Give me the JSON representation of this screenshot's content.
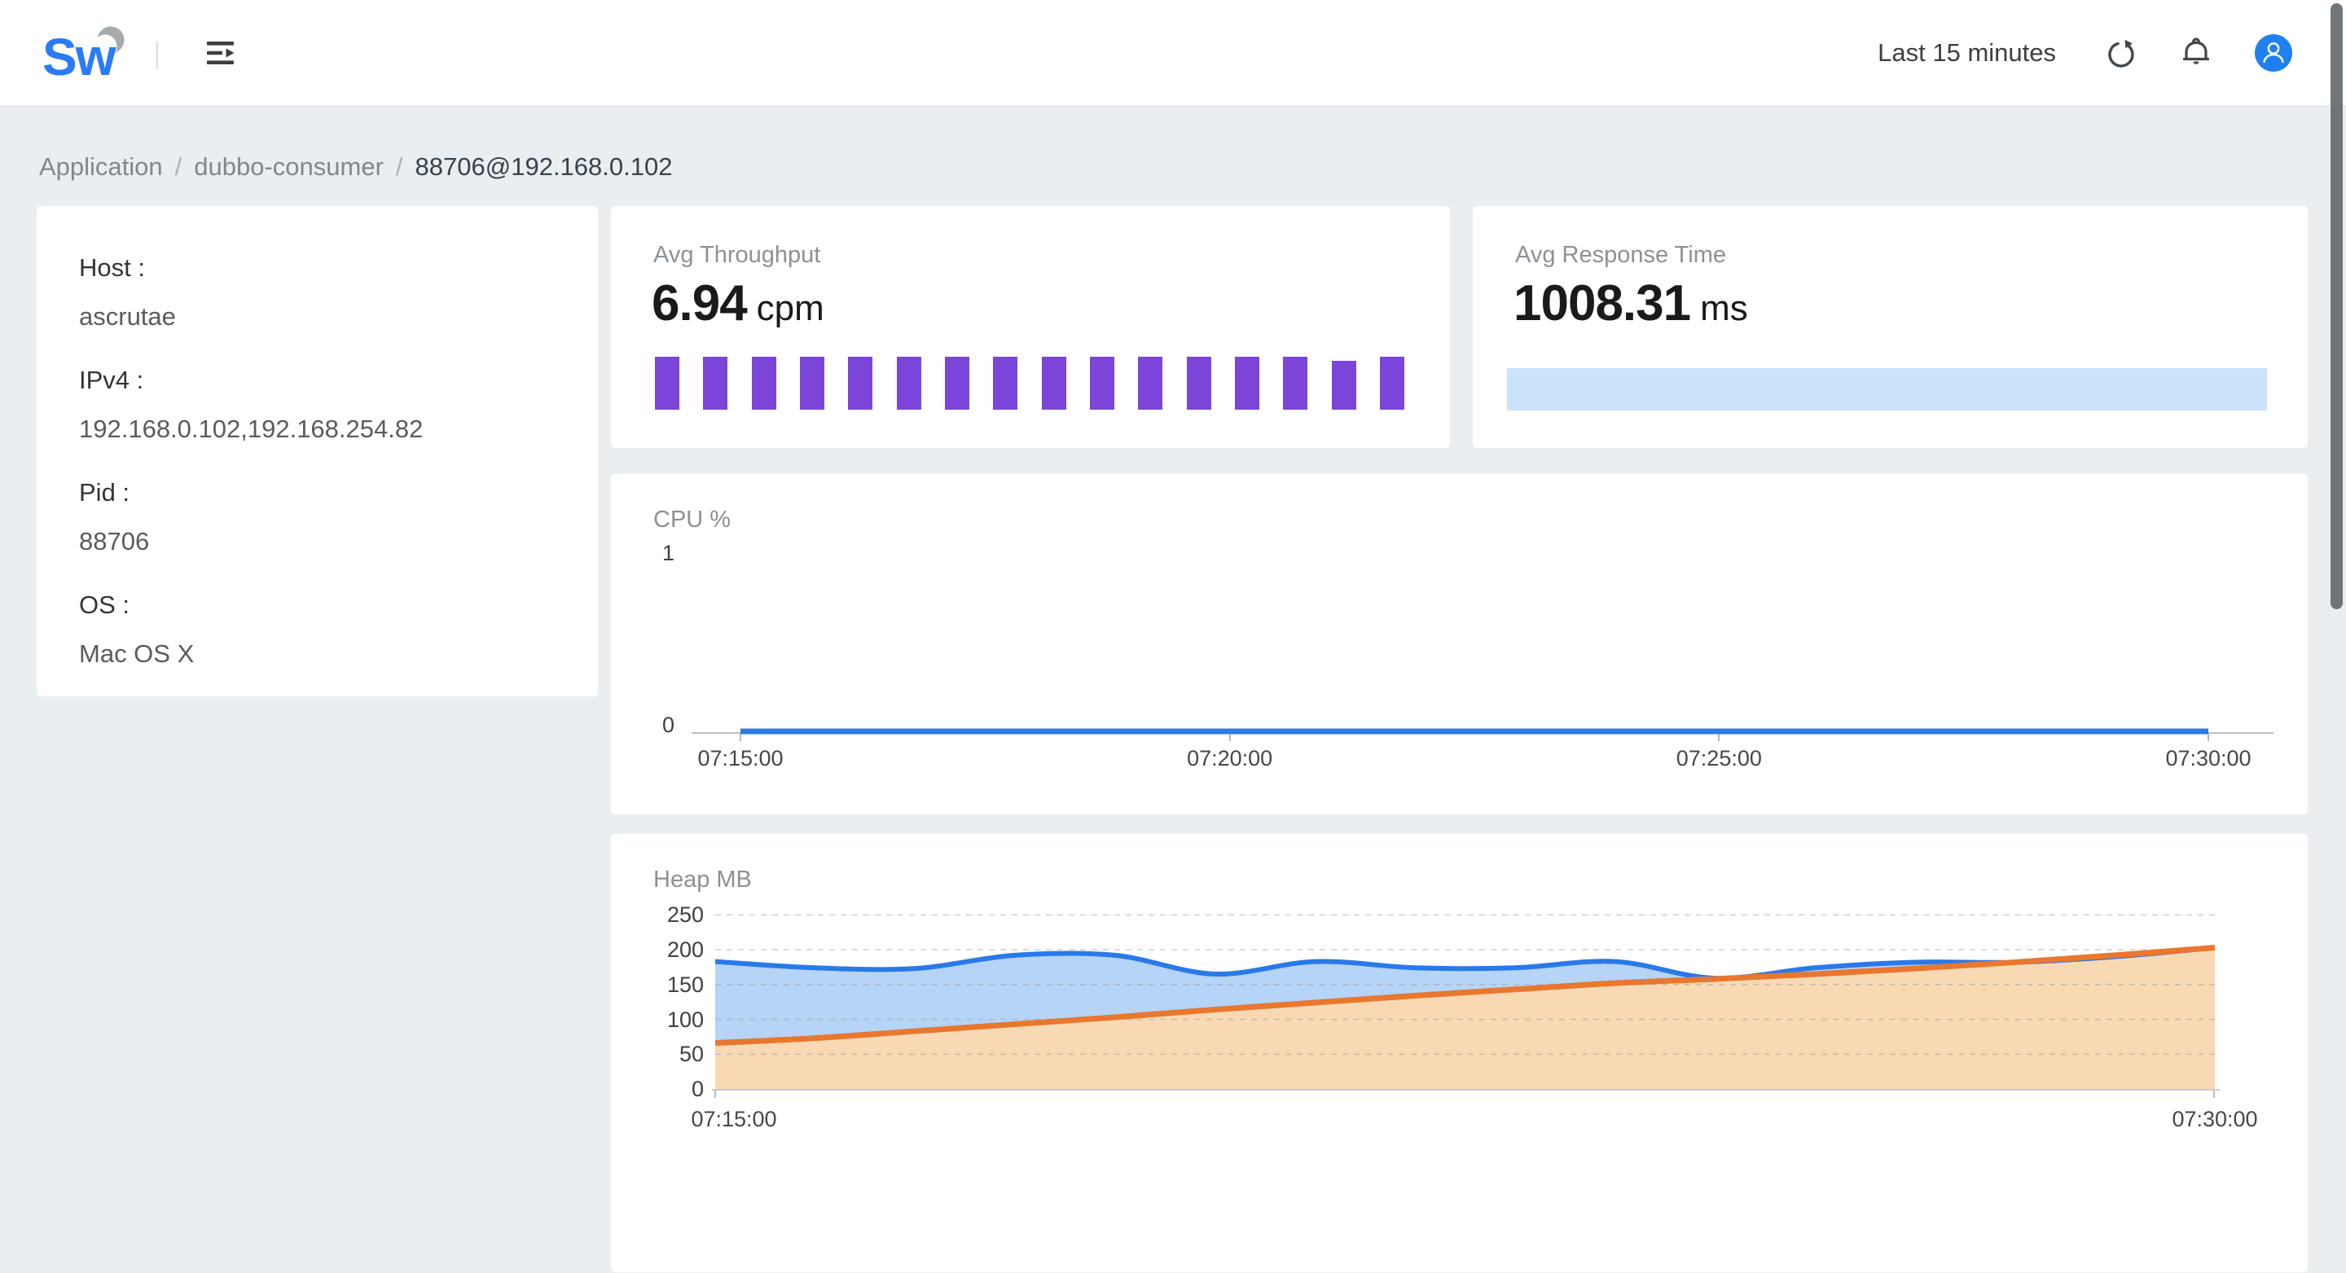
{
  "header": {
    "logo_text": "Sw",
    "time_range": "Last 15 minutes"
  },
  "breadcrumb": {
    "separator": "/",
    "items": [
      "Application",
      "dubbo-consumer",
      "88706@192.168.0.102"
    ]
  },
  "instance_info": {
    "fields": [
      {
        "label": "Host :",
        "value": "ascrutae"
      },
      {
        "label": "IPv4 :",
        "value": "192.168.0.102,192.168.254.82"
      },
      {
        "label": "Pid :",
        "value": "88706"
      },
      {
        "label": "OS :",
        "value": "Mac OS X"
      }
    ]
  },
  "metric_cards": {
    "throughput": {
      "title": "Avg Throughput",
      "value": "6.94",
      "unit": "cpm"
    },
    "response_time": {
      "title": "Avg Response Time",
      "value": "1008.31",
      "unit": "ms"
    }
  },
  "chart_data": [
    {
      "id": "throughput-spark",
      "type": "bar",
      "values": [
        7,
        7,
        7,
        7,
        7,
        7,
        7,
        7,
        7,
        7,
        7,
        7,
        7,
        7,
        6.5,
        7
      ],
      "ylim": [
        0,
        7
      ],
      "color": "#7c45d9"
    },
    {
      "id": "response-spark",
      "type": "bar",
      "values": [
        1008.31
      ],
      "ylim": [
        0,
        1008.31
      ],
      "color": "#cbe2fb"
    },
    {
      "id": "cpu",
      "type": "line",
      "title": "CPU %",
      "x_ticks": [
        "07:15:00",
        "07:20:00",
        "07:25:00",
        "07:30:00"
      ],
      "y_ticks": [
        0,
        1
      ],
      "ylim": [
        0,
        1
      ],
      "grid": false,
      "series": [
        {
          "name": "cpu-percent",
          "color": "#2e7ce0",
          "values": [
            0,
            0,
            0,
            0,
            0,
            0,
            0,
            0,
            0,
            0,
            0,
            0,
            0,
            0,
            0,
            0
          ]
        }
      ]
    },
    {
      "id": "heap",
      "type": "area",
      "title": "Heap MB",
      "x_ticks": [
        "07:15:00",
        "07:30:00"
      ],
      "y_ticks": [
        0,
        50,
        100,
        150,
        200,
        250
      ],
      "ylim": [
        0,
        296
      ],
      "grid": true,
      "series": [
        {
          "name": "heap-blue",
          "color": "#2979e8",
          "fill": "#b5d4f6",
          "values": [
            183,
            174,
            173,
            192,
            192,
            165,
            183,
            174,
            174,
            183,
            159,
            174,
            182,
            182,
            190,
            203
          ]
        },
        {
          "name": "heap-orange",
          "color": "#e9772e",
          "fill": "#f9d9b3",
          "values": [
            66,
            73,
            83,
            93,
            103,
            114,
            124,
            134,
            143,
            152,
            158,
            165,
            173,
            182,
            192,
            203
          ]
        }
      ]
    }
  ],
  "colors": {
    "page_bg": "#eaeef1",
    "card_bg": "#ffffff",
    "avatar_blue": "#2080f0",
    "logo_blue": "#2a7bf7",
    "throughput_purple": "#7c45d9",
    "response_bar_blue": "#cbe2fb",
    "cpu_line_blue": "#2e7ce0",
    "heap_line_blue": "#2979e8",
    "heap_fill_blue": "#b5d4f6",
    "heap_line_orange": "#e9772e",
    "heap_fill_orange": "#f9d9b3"
  }
}
